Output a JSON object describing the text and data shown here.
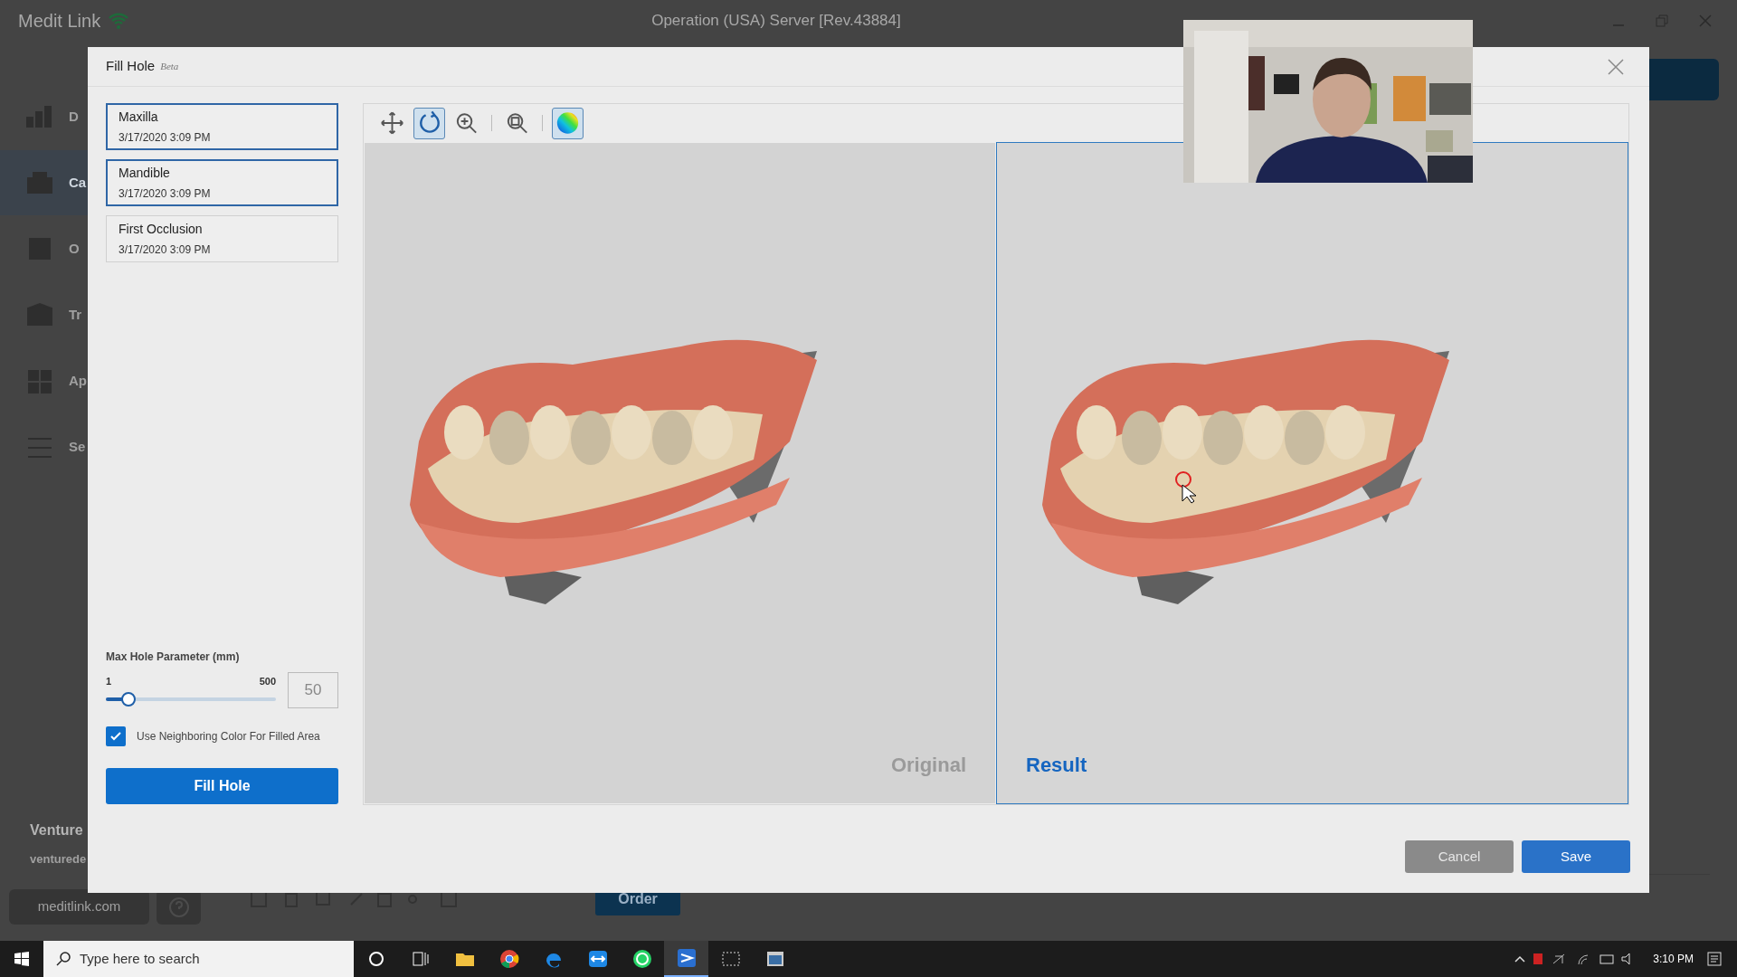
{
  "app": {
    "title": "Medit Link",
    "server": "Operation (USA) Server [Rev.43884]"
  },
  "background_sidebar": [
    {
      "label": "D",
      "selected": false
    },
    {
      "label": "Ca",
      "selected": true
    },
    {
      "label": "O",
      "selected": false
    },
    {
      "label": "Tr",
      "selected": false
    },
    {
      "label": "Ap",
      "selected": false
    },
    {
      "label": "Se",
      "selected": false
    }
  ],
  "background_user": {
    "name": "Venture",
    "email": "venturede"
  },
  "background_footer": {
    "link": "meditlink.com",
    "order_button": "Order"
  },
  "dialog": {
    "title": "Fill Hole",
    "badge": "Beta",
    "scans": [
      {
        "name": "Maxilla",
        "date": "3/17/2020 3:09 PM",
        "selected": true
      },
      {
        "name": "Mandible",
        "date": "3/17/2020 3:09 PM",
        "selected": true
      },
      {
        "name": "First Occlusion",
        "date": "3/17/2020 3:09 PM",
        "selected": false
      }
    ],
    "toolbar_groups": [
      {
        "tools": [
          {
            "kind": "pan",
            "selected": false
          },
          {
            "kind": "rotate",
            "selected": true
          },
          {
            "kind": "zoom-in",
            "selected": false
          }
        ]
      },
      {
        "tools": [
          {
            "kind": "zoom-fit",
            "selected": false
          }
        ]
      },
      {
        "tools": [
          {
            "kind": "color-map",
            "selected": true
          }
        ]
      }
    ],
    "views": [
      {
        "label": "Original",
        "selected": false
      },
      {
        "label": "Result",
        "selected": true
      }
    ],
    "parameter": {
      "label": "Max Hole Parameter (mm)",
      "min": "1",
      "max": "500",
      "level": 0.1,
      "value": "50"
    },
    "checkbox": {
      "label": "Use Neighboring Color For Filled Area",
      "checked": true
    },
    "fill_button": "Fill Hole",
    "buttons": [
      {
        "label": "Cancel",
        "kind": "secondary"
      },
      {
        "label": "Save",
        "kind": "primary"
      }
    ]
  },
  "taskbar": {
    "search_placeholder": "Type here to search",
    "apps": [
      {
        "kind": "cortana",
        "active": false
      },
      {
        "kind": "task-view",
        "active": false
      },
      {
        "kind": "folder",
        "active": false
      },
      {
        "kind": "chrome",
        "active": false
      },
      {
        "kind": "edge",
        "active": false
      },
      {
        "kind": "remote",
        "active": false
      },
      {
        "kind": "chat",
        "active": false
      },
      {
        "kind": "medit",
        "active": true
      },
      {
        "kind": "snip",
        "active": false
      },
      {
        "kind": "window",
        "active": false
      }
    ],
    "time": "3:10 PM"
  }
}
